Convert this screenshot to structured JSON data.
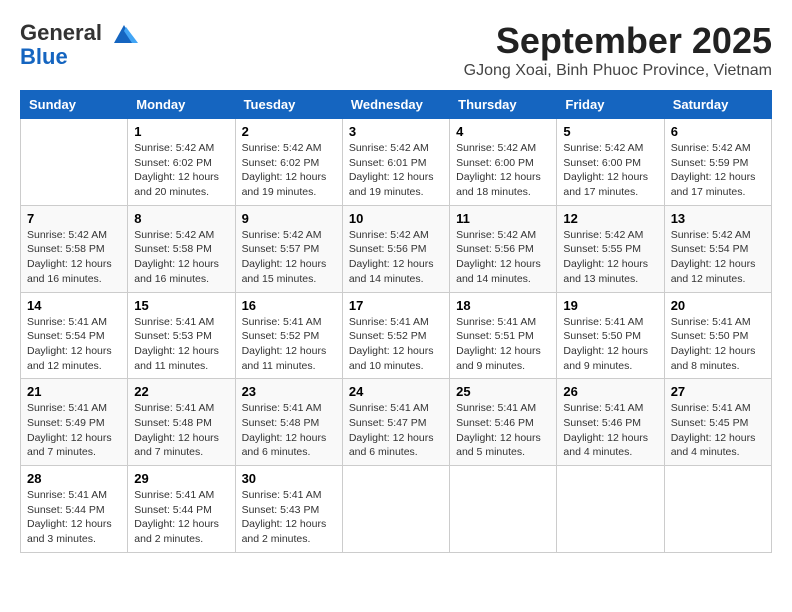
{
  "header": {
    "logo_line1": "General",
    "logo_line2": "Blue",
    "month_title": "September 2025",
    "location": "GJong Xoai, Binh Phuoc Province, Vietnam"
  },
  "columns": [
    "Sunday",
    "Monday",
    "Tuesday",
    "Wednesday",
    "Thursday",
    "Friday",
    "Saturday"
  ],
  "weeks": [
    [
      {
        "num": "",
        "info": ""
      },
      {
        "num": "1",
        "info": "Sunrise: 5:42 AM\nSunset: 6:02 PM\nDaylight: 12 hours\nand 20 minutes."
      },
      {
        "num": "2",
        "info": "Sunrise: 5:42 AM\nSunset: 6:02 PM\nDaylight: 12 hours\nand 19 minutes."
      },
      {
        "num": "3",
        "info": "Sunrise: 5:42 AM\nSunset: 6:01 PM\nDaylight: 12 hours\nand 19 minutes."
      },
      {
        "num": "4",
        "info": "Sunrise: 5:42 AM\nSunset: 6:00 PM\nDaylight: 12 hours\nand 18 minutes."
      },
      {
        "num": "5",
        "info": "Sunrise: 5:42 AM\nSunset: 6:00 PM\nDaylight: 12 hours\nand 17 minutes."
      },
      {
        "num": "6",
        "info": "Sunrise: 5:42 AM\nSunset: 5:59 PM\nDaylight: 12 hours\nand 17 minutes."
      }
    ],
    [
      {
        "num": "7",
        "info": "Sunrise: 5:42 AM\nSunset: 5:58 PM\nDaylight: 12 hours\nand 16 minutes."
      },
      {
        "num": "8",
        "info": "Sunrise: 5:42 AM\nSunset: 5:58 PM\nDaylight: 12 hours\nand 16 minutes."
      },
      {
        "num": "9",
        "info": "Sunrise: 5:42 AM\nSunset: 5:57 PM\nDaylight: 12 hours\nand 15 minutes."
      },
      {
        "num": "10",
        "info": "Sunrise: 5:42 AM\nSunset: 5:56 PM\nDaylight: 12 hours\nand 14 minutes."
      },
      {
        "num": "11",
        "info": "Sunrise: 5:42 AM\nSunset: 5:56 PM\nDaylight: 12 hours\nand 14 minutes."
      },
      {
        "num": "12",
        "info": "Sunrise: 5:42 AM\nSunset: 5:55 PM\nDaylight: 12 hours\nand 13 minutes."
      },
      {
        "num": "13",
        "info": "Sunrise: 5:42 AM\nSunset: 5:54 PM\nDaylight: 12 hours\nand 12 minutes."
      }
    ],
    [
      {
        "num": "14",
        "info": "Sunrise: 5:41 AM\nSunset: 5:54 PM\nDaylight: 12 hours\nand 12 minutes."
      },
      {
        "num": "15",
        "info": "Sunrise: 5:41 AM\nSunset: 5:53 PM\nDaylight: 12 hours\nand 11 minutes."
      },
      {
        "num": "16",
        "info": "Sunrise: 5:41 AM\nSunset: 5:52 PM\nDaylight: 12 hours\nand 11 minutes."
      },
      {
        "num": "17",
        "info": "Sunrise: 5:41 AM\nSunset: 5:52 PM\nDaylight: 12 hours\nand 10 minutes."
      },
      {
        "num": "18",
        "info": "Sunrise: 5:41 AM\nSunset: 5:51 PM\nDaylight: 12 hours\nand 9 minutes."
      },
      {
        "num": "19",
        "info": "Sunrise: 5:41 AM\nSunset: 5:50 PM\nDaylight: 12 hours\nand 9 minutes."
      },
      {
        "num": "20",
        "info": "Sunrise: 5:41 AM\nSunset: 5:50 PM\nDaylight: 12 hours\nand 8 minutes."
      }
    ],
    [
      {
        "num": "21",
        "info": "Sunrise: 5:41 AM\nSunset: 5:49 PM\nDaylight: 12 hours\nand 7 minutes."
      },
      {
        "num": "22",
        "info": "Sunrise: 5:41 AM\nSunset: 5:48 PM\nDaylight: 12 hours\nand 7 minutes."
      },
      {
        "num": "23",
        "info": "Sunrise: 5:41 AM\nSunset: 5:48 PM\nDaylight: 12 hours\nand 6 minutes."
      },
      {
        "num": "24",
        "info": "Sunrise: 5:41 AM\nSunset: 5:47 PM\nDaylight: 12 hours\nand 6 minutes."
      },
      {
        "num": "25",
        "info": "Sunrise: 5:41 AM\nSunset: 5:46 PM\nDaylight: 12 hours\nand 5 minutes."
      },
      {
        "num": "26",
        "info": "Sunrise: 5:41 AM\nSunset: 5:46 PM\nDaylight: 12 hours\nand 4 minutes."
      },
      {
        "num": "27",
        "info": "Sunrise: 5:41 AM\nSunset: 5:45 PM\nDaylight: 12 hours\nand 4 minutes."
      }
    ],
    [
      {
        "num": "28",
        "info": "Sunrise: 5:41 AM\nSunset: 5:44 PM\nDaylight: 12 hours\nand 3 minutes."
      },
      {
        "num": "29",
        "info": "Sunrise: 5:41 AM\nSunset: 5:44 PM\nDaylight: 12 hours\nand 2 minutes."
      },
      {
        "num": "30",
        "info": "Sunrise: 5:41 AM\nSunset: 5:43 PM\nDaylight: 12 hours\nand 2 minutes."
      },
      {
        "num": "",
        "info": ""
      },
      {
        "num": "",
        "info": ""
      },
      {
        "num": "",
        "info": ""
      },
      {
        "num": "",
        "info": ""
      }
    ]
  ]
}
